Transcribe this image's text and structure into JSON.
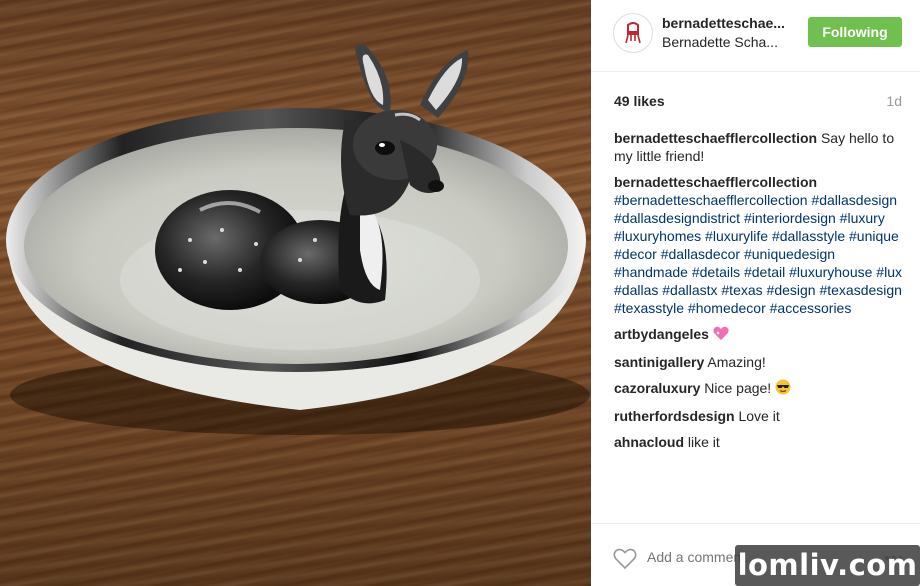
{
  "post": {
    "header": {
      "handle": "bernadetteschae...",
      "display_name": "Bernadette Scha...",
      "follow_label": "Following",
      "follow_color": "#70c050"
    },
    "stats": {
      "likes": "49 likes",
      "age": "1d"
    },
    "comments": [
      {
        "user": "bernadetteschaefflercollection",
        "text": "Say hello to my little friend!",
        "kind": "text"
      },
      {
        "user": "bernadetteschaefflercollection",
        "text": "#bernadetteschaefflercollection #dallasdesign #dallasdesigndistrict #interiordesign #luxury #luxuryhomes #luxurylife #dallasstyle #unique #decor #dallasdecor #uniquedesign #handmade #details #detail #luxuryhouse #lux #dallas #dallastx #texas #design #texasdesign #texasstyle #homedecor #accessories",
        "kind": "tags"
      },
      {
        "user": "artbydangeles",
        "text": "",
        "emoji": "pink-heart-icon"
      },
      {
        "user": "santinigallery",
        "text": "Amazing!"
      },
      {
        "user": "cazoraluxury",
        "text": "Nice page!",
        "emoji": "sunglasses-face-icon"
      },
      {
        "user": "rutherfordsdesign",
        "text": "Love it"
      },
      {
        "user": "ahnacloud",
        "text": "like it"
      }
    ],
    "footer": {
      "add_comment_placeholder": "Add a comment...",
      "more_label": "•••"
    },
    "hashtag_color": "#003569"
  },
  "watermark": {
    "text": "lomliv.com"
  }
}
